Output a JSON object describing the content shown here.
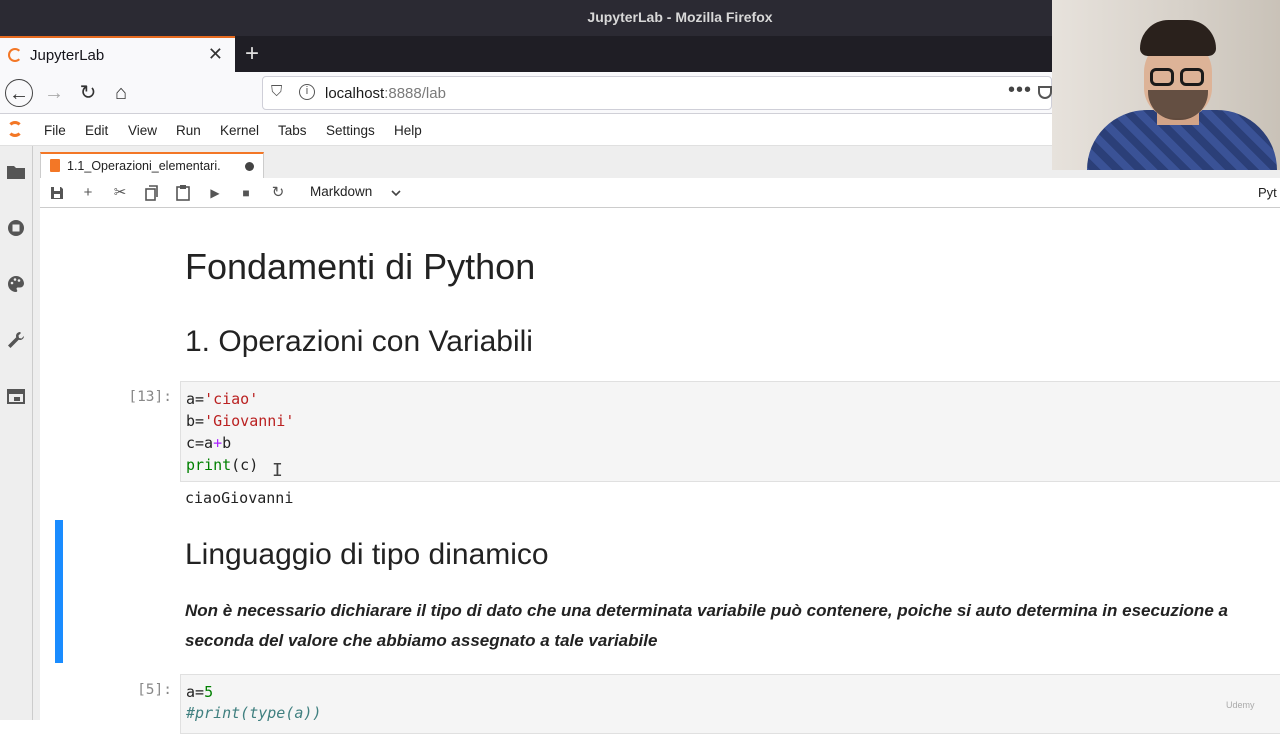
{
  "window": {
    "title": "JupyterLab - Mozilla Firefox"
  },
  "browser": {
    "tab_label": "JupyterLab",
    "url_host": "localhost",
    "url_rest": ":8888/lab"
  },
  "menu": {
    "items": [
      "File",
      "Edit",
      "View",
      "Run",
      "Kernel",
      "Tabs",
      "Settings",
      "Help"
    ]
  },
  "notebook": {
    "tab_label": "1.1_Operazioni_elementari.",
    "cell_type": "Markdown",
    "kernel": "Pyt",
    "h1": "Fondamenti di Python",
    "h2_ops": "1. Operazioni con Variabili",
    "cell1": {
      "prompt": "[13]:",
      "l1_var": "a=",
      "l1_str": "'ciao'",
      "l2_var": "b=",
      "l2_str": "'Giovanni'",
      "l3_a": "c=a",
      "l3_op": "+",
      "l3_b": "b",
      "l4_fn": "print",
      "l4_args": "(c)",
      "output": "ciaoGiovanni"
    },
    "h2_dyn": "Linguaggio di tipo dinamico",
    "para_line1": "Non è necessario dichiarare il tipo di dato che una determinata variabile può contenere, poiche si auto determina in esecuzione a",
    "para_line2": "seconda del valore che abbiamo assegnato a tale variabile",
    "cell2": {
      "prompt": "[5]:",
      "l1_var": "a=",
      "l1_num": "5",
      "l2_comment": "#print(type(a))"
    }
  },
  "watermark": "Udemy",
  "colors": {
    "accent": "#f37726",
    "active_cell": "#1a8cff",
    "string": "#ba2121",
    "keyword": "#008000"
  }
}
